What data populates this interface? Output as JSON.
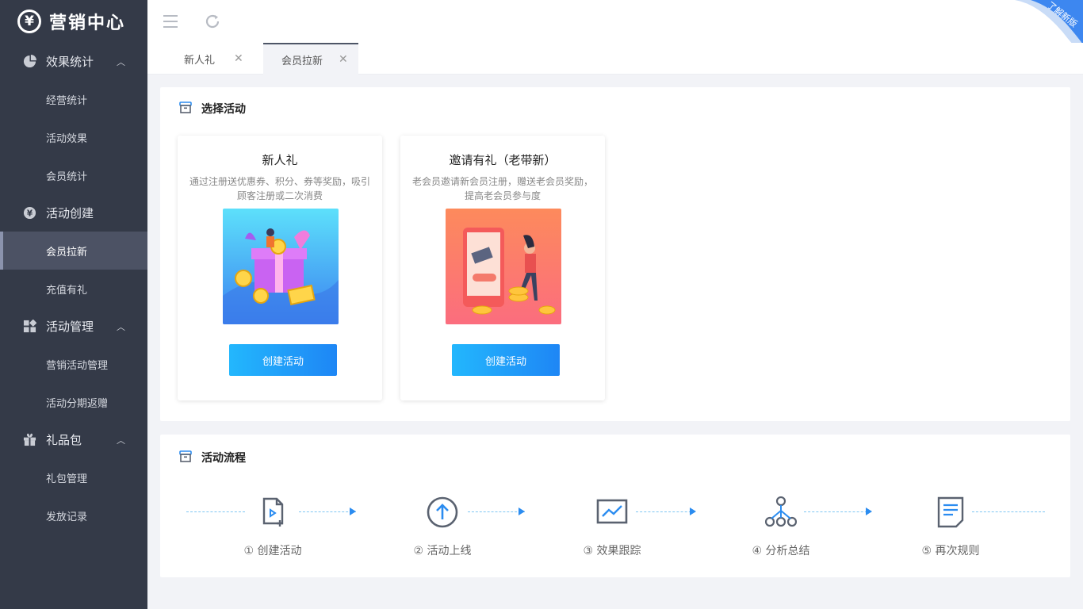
{
  "app": {
    "logo_glyph": "¥",
    "title": "营销中心"
  },
  "sidebar": {
    "groups": [
      {
        "label": "效果统计",
        "icon": "pie-chart-icon",
        "items": [
          "经营统计",
          "活动效果",
          "会员统计"
        ]
      },
      {
        "label": "活动创建",
        "icon": "yen-circle-icon",
        "items": [
          "会员拉新",
          "充值有礼"
        ]
      },
      {
        "label": "活动管理",
        "icon": "grid-icon",
        "items": [
          "营销活动管理",
          "活动分期返赠"
        ]
      },
      {
        "label": "礼品包",
        "icon": "gift-icon",
        "items": [
          "礼包管理",
          "发放记录"
        ]
      }
    ],
    "active_item": "会员拉新"
  },
  "topbar": {
    "menu_icon": "menu-icon",
    "refresh_icon": "refresh-icon",
    "corner_badge": "了解新版"
  },
  "tabs": [
    {
      "label": "新人礼",
      "close": "✕"
    },
    {
      "label": "会员拉新",
      "close": "✕",
      "active": true
    }
  ],
  "select_panel": {
    "title": "选择活动",
    "cards": [
      {
        "title": "新人礼",
        "desc": "通过注册送优惠券、积分、券等奖励，吸引顾客注册或二次消费",
        "button": "创建活动"
      },
      {
        "title": "邀请有礼（老带新）",
        "desc": "老会员邀请新会员注册，赠送老会员奖励，提高老会员参与度",
        "button": "创建活动"
      }
    ]
  },
  "flow_panel": {
    "title": "活动流程",
    "steps": [
      {
        "label": "① 创建活动",
        "icon": "file-add-icon"
      },
      {
        "label": "② 活动上线",
        "icon": "upload-circle-icon"
      },
      {
        "label": "③ 效果跟踪",
        "icon": "trend-chart-icon"
      },
      {
        "label": "④ 分析总结",
        "icon": "network-icon"
      },
      {
        "label": "⑤ 再次规则",
        "icon": "document-icon"
      }
    ]
  },
  "colors": {
    "sidebar": "#343a48",
    "accent": "#1e86f5",
    "flow_icon": "#5a6270"
  }
}
